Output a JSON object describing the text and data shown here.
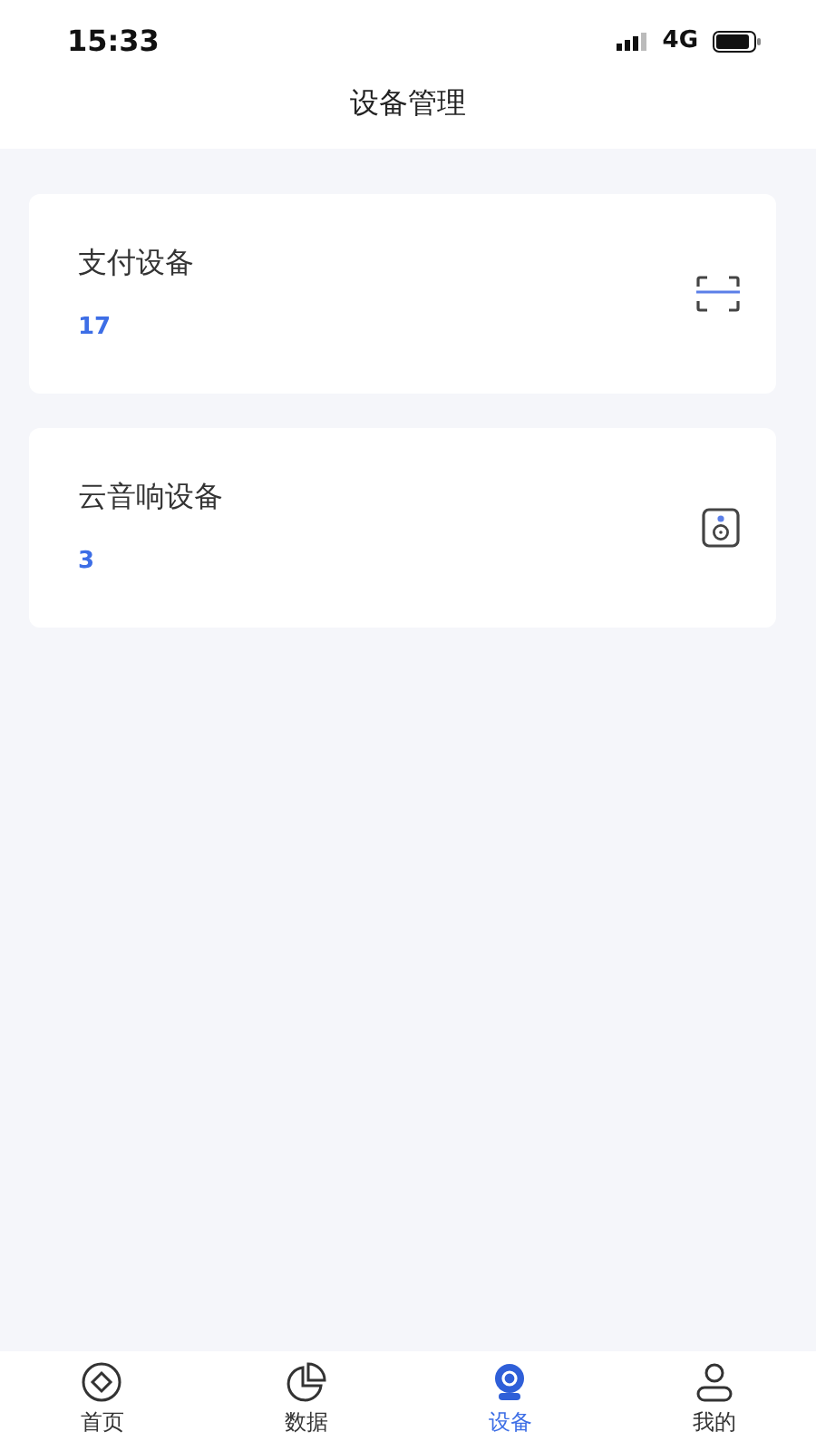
{
  "status_bar": {
    "time": "15:33",
    "network": "4G"
  },
  "header": {
    "title": "设备管理"
  },
  "devices": [
    {
      "name": "支付设备",
      "count": "17",
      "kind": "scan"
    },
    {
      "name": "云音响设备",
      "count": "3",
      "kind": "speaker"
    }
  ],
  "tabs": [
    {
      "label": "首页",
      "kind": "home",
      "selected": false
    },
    {
      "label": "数据",
      "kind": "data",
      "selected": false
    },
    {
      "label": "设备",
      "kind": "device",
      "selected": true
    },
    {
      "label": "我的",
      "kind": "me",
      "selected": false
    }
  ]
}
